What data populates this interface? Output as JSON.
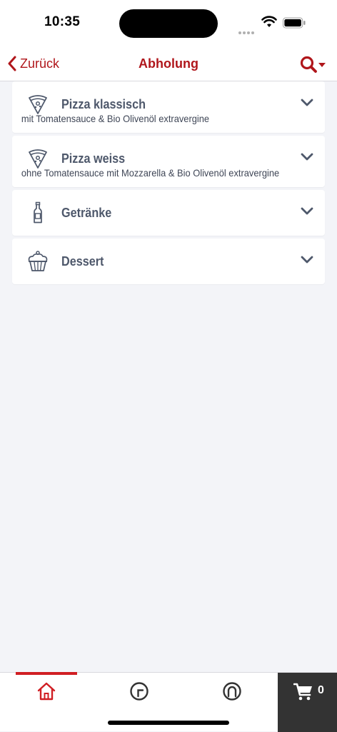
{
  "status": {
    "time": "10:35"
  },
  "nav": {
    "back_label": "Zurück",
    "title": "Abholung"
  },
  "categories": [
    {
      "name": "Pizza klassisch",
      "icon": "pizza-slice-icon",
      "description": "mit Tomatensauce & Bio Olivenöl extravergine"
    },
    {
      "name": "Pizza weiss",
      "icon": "pizza-slice-icon",
      "description": "ohne Tomatensauce mit Mozzarella & Bio Olivenöl extravergine"
    },
    {
      "name": "Getränke",
      "icon": "bottle-icon",
      "description": ""
    },
    {
      "name": "Dessert",
      "icon": "cupcake-icon",
      "description": ""
    }
  ],
  "tabs": [
    {
      "name": "home",
      "icon": "home-icon",
      "active": true
    },
    {
      "name": "history",
      "icon": "clock-icon",
      "active": false
    },
    {
      "name": "account",
      "icon": "user-circle-icon",
      "active": false
    }
  ],
  "cart": {
    "count": "0"
  },
  "colors": {
    "accent": "#b0161b",
    "tab_active": "#d01e23",
    "text": "#4e586b",
    "cart_bg": "#333333",
    "background": "#f3f4f8"
  }
}
